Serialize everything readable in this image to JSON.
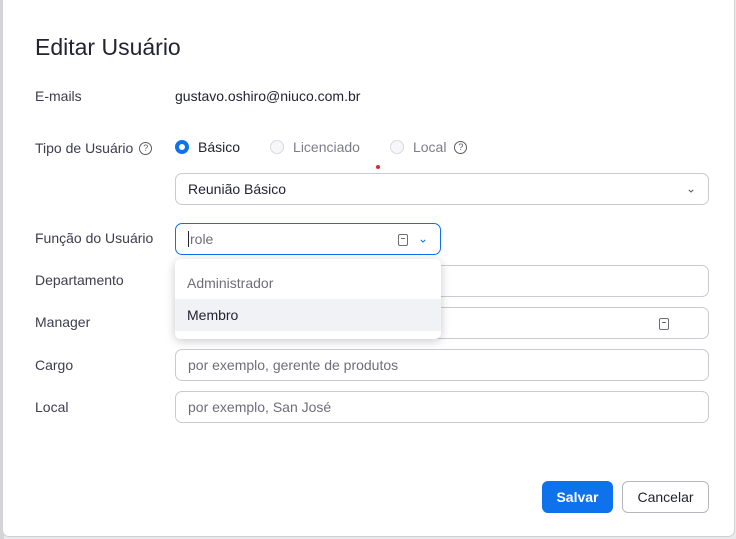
{
  "dialog": {
    "title": "Editar Usuário"
  },
  "fields": {
    "emails": {
      "label": "E-mails",
      "value": "gustavo.oshiro@niuco.com.br"
    },
    "user_type": {
      "label": "Tipo de Usuário",
      "options": [
        {
          "label": "Básico",
          "selected": true
        },
        {
          "label": "Licenciado",
          "selected": false
        },
        {
          "label": "Local",
          "selected": false
        }
      ],
      "plan_select_value": "Reunião Básico"
    },
    "role": {
      "label": "Função do Usuário",
      "value": "role",
      "dropdown_options": [
        "Administrador",
        "Membro"
      ]
    },
    "department": {
      "label": "Departamento",
      "value": ""
    },
    "manager": {
      "label": "Manager",
      "value": ""
    },
    "job_title": {
      "label": "Cargo",
      "placeholder": "por exemplo, gerente de produtos"
    },
    "location": {
      "label": "Local",
      "placeholder": "por exemplo, San José"
    }
  },
  "actions": {
    "save_label": "Salvar",
    "cancel_label": "Cancelar"
  },
  "colors": {
    "accent": "#0e72ed",
    "text": "#232333",
    "border": "#c9cbd1"
  }
}
